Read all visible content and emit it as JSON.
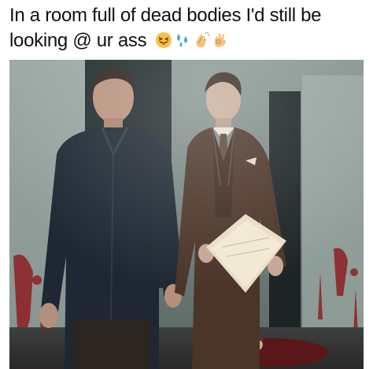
{
  "meme": {
    "caption_line1": "In a room full of dead bodies I'd still be",
    "caption_line2": "looking @ ur ass",
    "emojis": [
      "tongue-out-face-icon",
      "sweat-droplets-icon",
      "clapping-hands-icon",
      "ok-hand-icon"
    ]
  },
  "photo": {
    "description_icon": "tv-still-photo",
    "colors": {
      "wall": "#7f8d89",
      "door": "#1f2a2c",
      "blood": "#8e1f22",
      "suit_brown": "#4b3428",
      "jacket_dark": "#1e2733",
      "paper": "#e9dcc2"
    }
  }
}
